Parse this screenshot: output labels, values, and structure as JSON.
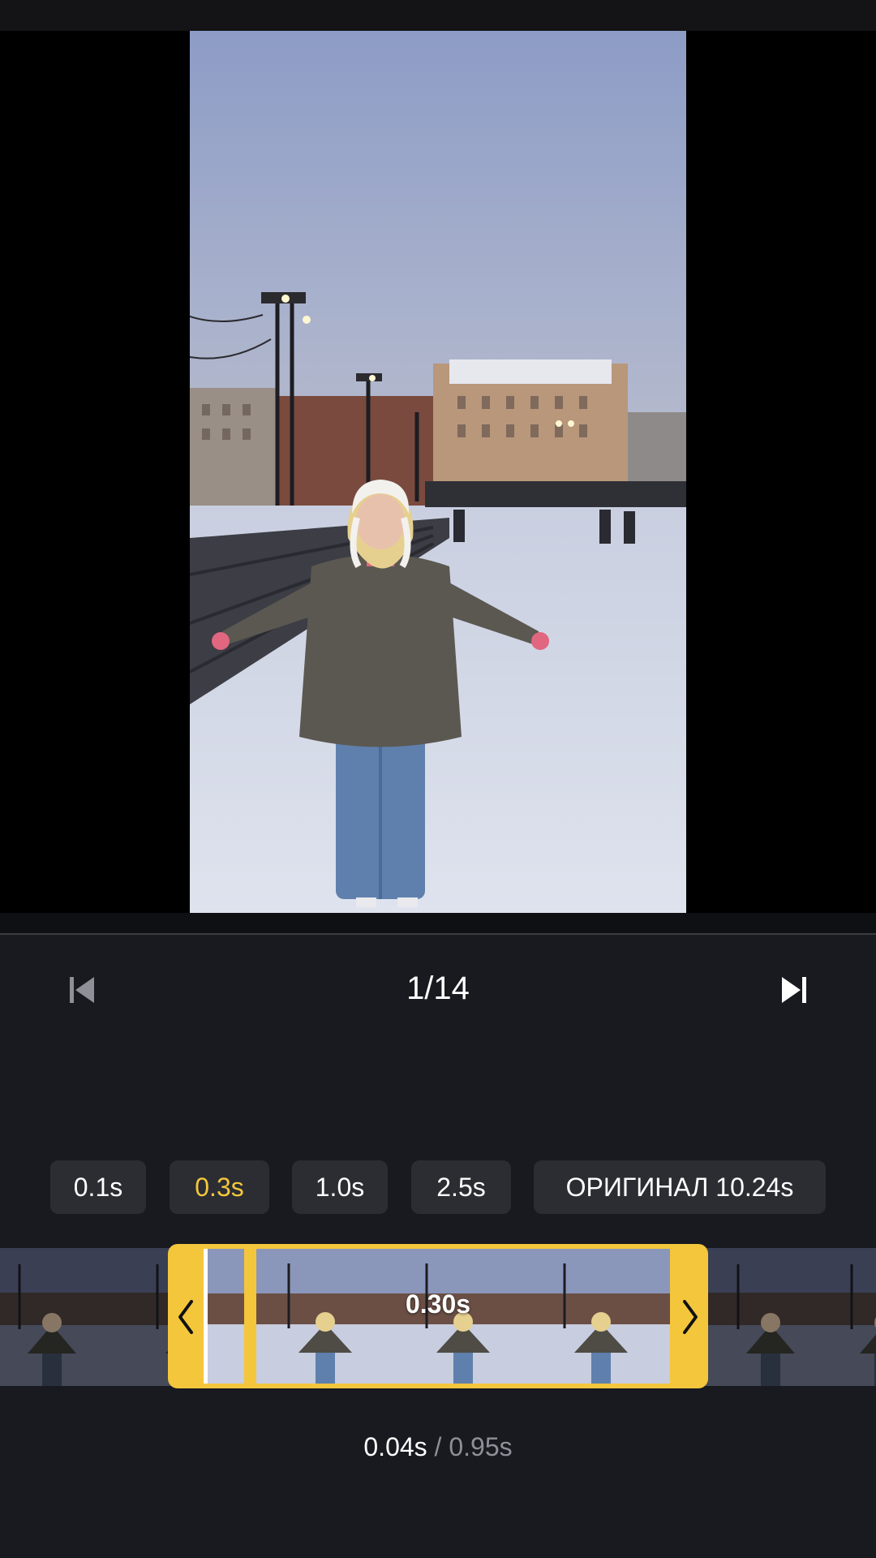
{
  "navigation": {
    "prev_icon": "skip-previous-icon",
    "next_icon": "skip-next-icon",
    "frame_counter": "1/14"
  },
  "speed_options": [
    {
      "label": "0.1s",
      "selected": false
    },
    {
      "label": "0.3s",
      "selected": true
    },
    {
      "label": "1.0s",
      "selected": false
    },
    {
      "label": "2.5s",
      "selected": false
    },
    {
      "label": "ОРИГИНАЛ 10.24s",
      "selected": false
    }
  ],
  "timeline": {
    "selected_duration": "0.30s",
    "left_handle_icon": "chevron-left-icon",
    "right_handle_icon": "chevron-right-icon"
  },
  "timing": {
    "current": "0.04s",
    "total": " / 0.95s"
  },
  "colors": {
    "accent": "#f4c63b",
    "background": "#181a20",
    "button_bg": "#2b2d33"
  }
}
